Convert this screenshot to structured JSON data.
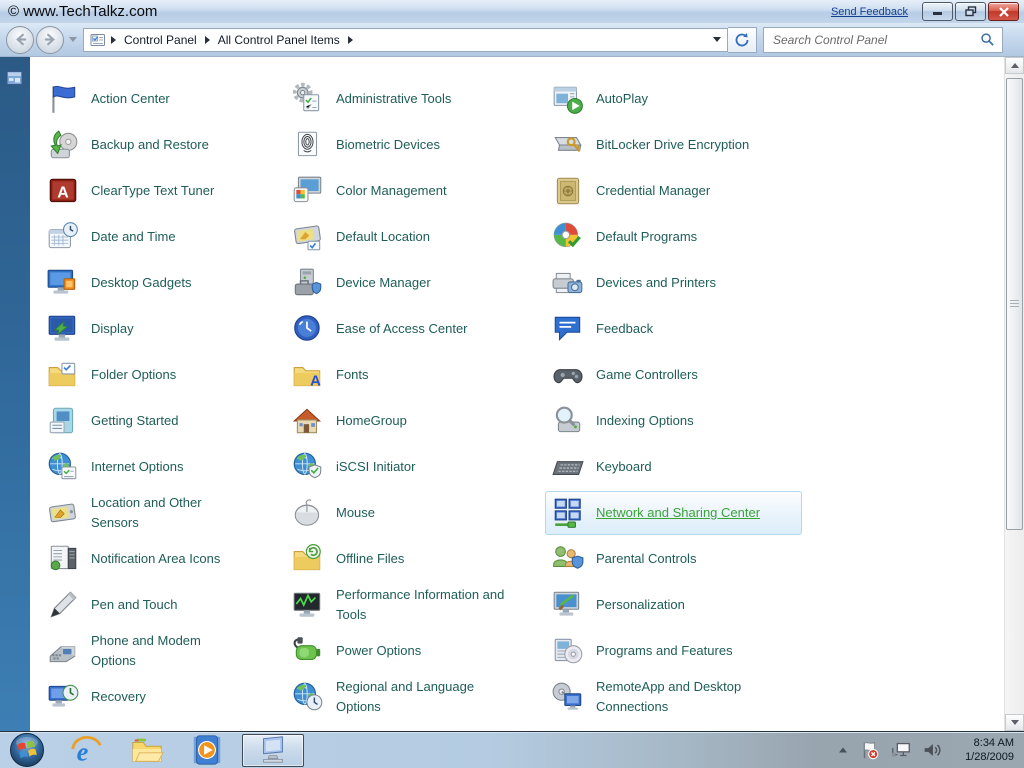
{
  "window": {
    "title": "© www.TechTalkz.com",
    "send_feedback": "Send Feedback"
  },
  "navbar": {
    "breadcrumb": [
      "Control Panel",
      "All Control Panel Items"
    ],
    "search_placeholder": "Search Control Panel"
  },
  "content": {
    "columns": [
      {
        "items": [
          {
            "label": "Action Center",
            "icon": "action-center"
          },
          {
            "label": "Backup and Restore",
            "icon": "backup-restore"
          },
          {
            "label": "ClearType Text Tuner",
            "icon": "cleartype"
          },
          {
            "label": "Date and Time",
            "icon": "date-time"
          },
          {
            "label": "Desktop Gadgets",
            "icon": "desktop-gadgets"
          },
          {
            "label": "Display",
            "icon": "display"
          },
          {
            "label": "Folder Options",
            "icon": "folder-options"
          },
          {
            "label": "Getting Started",
            "icon": "getting-started"
          },
          {
            "label": "Internet Options",
            "icon": "internet-options"
          },
          {
            "label": "Location and Other Sensors",
            "icon": "location-sensors"
          },
          {
            "label": "Notification Area Icons",
            "icon": "notification-area"
          },
          {
            "label": "Pen and Touch",
            "icon": "pen-touch"
          },
          {
            "label": "Phone and Modem Options",
            "icon": "phone-modem"
          },
          {
            "label": "Recovery",
            "icon": "recovery"
          }
        ]
      },
      {
        "items": [
          {
            "label": "Administrative Tools",
            "icon": "admin-tools"
          },
          {
            "label": "Biometric Devices",
            "icon": "biometric"
          },
          {
            "label": "Color Management",
            "icon": "color-mgmt"
          },
          {
            "label": "Default Location",
            "icon": "default-location"
          },
          {
            "label": "Device Manager",
            "icon": "device-manager"
          },
          {
            "label": "Ease of Access Center",
            "icon": "ease-access"
          },
          {
            "label": "Fonts",
            "icon": "fonts"
          },
          {
            "label": "HomeGroup",
            "icon": "homegroup"
          },
          {
            "label": "iSCSI Initiator",
            "icon": "iscsi"
          },
          {
            "label": "Mouse",
            "icon": "mouse"
          },
          {
            "label": "Offline Files",
            "icon": "offline-files"
          },
          {
            "label": "Performance Information and Tools",
            "icon": "performance"
          },
          {
            "label": "Power Options",
            "icon": "power"
          },
          {
            "label": "Regional and Language Options",
            "icon": "regional"
          }
        ]
      },
      {
        "items": [
          {
            "label": "AutoPlay",
            "icon": "autoplay"
          },
          {
            "label": "BitLocker Drive Encryption",
            "icon": "bitlocker"
          },
          {
            "label": "Credential Manager",
            "icon": "credential"
          },
          {
            "label": "Default Programs",
            "icon": "default-programs"
          },
          {
            "label": "Devices and Printers",
            "icon": "devices-printers"
          },
          {
            "label": "Feedback",
            "icon": "feedback"
          },
          {
            "label": "Game Controllers",
            "icon": "game-controllers"
          },
          {
            "label": "Indexing Options",
            "icon": "indexing"
          },
          {
            "label": "Keyboard",
            "icon": "keyboard"
          },
          {
            "label": "Network and Sharing Center",
            "icon": "network-sharing",
            "selected": true
          },
          {
            "label": "Parental Controls",
            "icon": "parental"
          },
          {
            "label": "Personalization",
            "icon": "personalization"
          },
          {
            "label": "Programs and Features",
            "icon": "programs-features"
          },
          {
            "label": "RemoteApp and Desktop Connections",
            "icon": "remoteapp"
          }
        ]
      }
    ]
  },
  "taskbar": {
    "time": "8:34 AM",
    "date": "1/28/2009"
  },
  "colors": {
    "item_link": "#1e5d58",
    "selected_link": "#3ba339",
    "selected_border": "#b5d7ec",
    "desktop_strip_top": "#2b5a85",
    "desktop_strip_bottom": "#3d7fb4",
    "taskbar_left": "#bad0e7",
    "taskbar_right": "#9aa6b0",
    "close_button_red": "#c03a28",
    "feedback_link_blue": "#15408f"
  }
}
